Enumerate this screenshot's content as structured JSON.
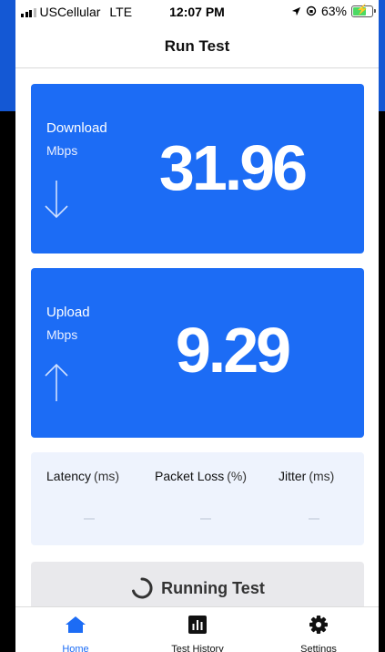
{
  "status_bar": {
    "carrier": "USCellular",
    "network": "LTE",
    "time": "12:07 PM",
    "battery": "63%"
  },
  "header": {
    "title": "Run Test"
  },
  "download": {
    "label": "Download",
    "unit": "Mbps",
    "value": "31.96"
  },
  "upload": {
    "label": "Upload",
    "unit": "Mbps",
    "value": "9.29"
  },
  "metrics": [
    {
      "label": "Latency",
      "unit": "(ms)",
      "value": "–"
    },
    {
      "label": "Packet Loss",
      "unit": "(%)",
      "value": "–"
    },
    {
      "label": "Jitter",
      "unit": "(ms)",
      "value": "–"
    }
  ],
  "status": {
    "label": "Running Test"
  },
  "tabs": [
    {
      "label": "Home",
      "icon": "home-icon",
      "active": true
    },
    {
      "label": "Test History",
      "icon": "chart-icon",
      "active": false
    },
    {
      "label": "Settings",
      "icon": "gear-icon",
      "active": false
    }
  ],
  "colors": {
    "accent": "#1c6cf5",
    "metrics_bg": "#eef3fd",
    "running_bg": "#e9e9ec"
  }
}
